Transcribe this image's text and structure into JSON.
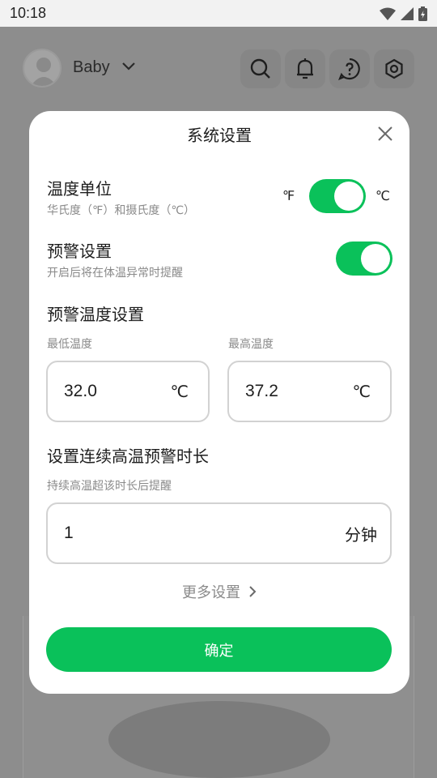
{
  "status_bar": {
    "time": "10:18"
  },
  "profile": {
    "name": "Baby"
  },
  "dialog": {
    "title": "系统设置",
    "temp_unit": {
      "title": "温度单位",
      "subtitle": "华氏度（℉）和摄氏度（℃）",
      "left_label": "℉",
      "right_label": "℃",
      "selected": "℃"
    },
    "alert": {
      "title": "预警设置",
      "subtitle": "开启后将在体温异常时提醒",
      "enabled": true
    },
    "alert_temp": {
      "title": "预警温度设置",
      "min_label": "最低温度",
      "min_value": "32.0",
      "max_label": "最高温度",
      "max_value": "37.2",
      "unit": "℃"
    },
    "duration": {
      "title": "设置连续高温预警时长",
      "subtitle": "持续高温超该时长后提醒",
      "value": "1",
      "unit": "分钟"
    },
    "more_settings": "更多设置",
    "confirm": "确定"
  },
  "colors": {
    "accent": "#0ac15a",
    "overlay": "#8d8d8d"
  }
}
